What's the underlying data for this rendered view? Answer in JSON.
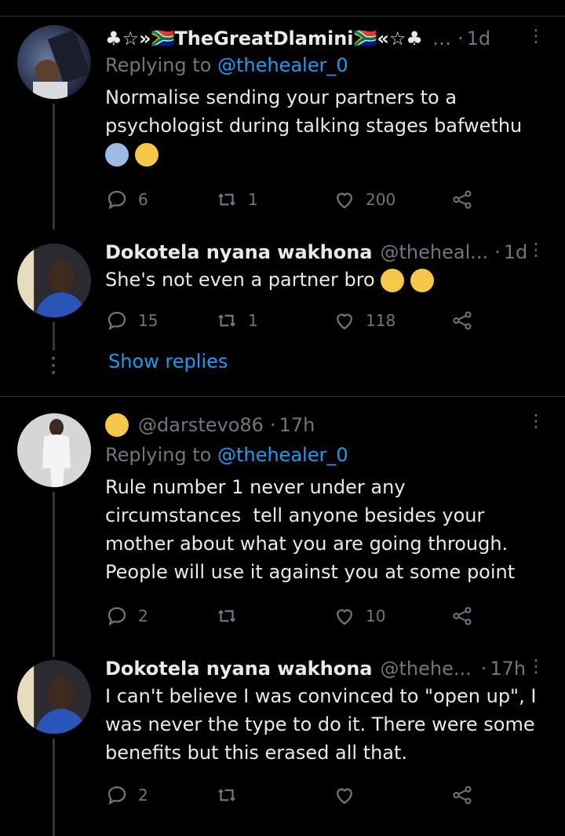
{
  "tweets": [
    {
      "name": "♣☆»🇿🇦TheGreatDlamini🇿🇦«☆♣",
      "handle": "…",
      "time": "1d",
      "replying_label": "Replying to",
      "replying_to": "@thehealer_0",
      "text": "Normalise sending your partners to a psychologist during talking stages bafwethu",
      "reply_count": "6",
      "retweet_count": "1",
      "like_count": "200"
    },
    {
      "name": "Dokotela nyana wakhona",
      "handle": "@theheal...",
      "time": "1d",
      "text": "She's not even a partner bro",
      "reply_count": "15",
      "retweet_count": "1",
      "like_count": "118"
    },
    {
      "name": "",
      "handle": "@darstevo86",
      "time": "17h",
      "replying_label": "Replying to",
      "replying_to": "@thehealer_0",
      "text": "Rule number 1 never under any circumstances  tell anyone besides your mother about what you are going through. People will use it against you at some point",
      "reply_count": "2",
      "retweet_count": "",
      "like_count": "10"
    },
    {
      "name": "Dokotela nyana wakhona",
      "handle": "@thehe...",
      "time": "17h",
      "text": "I can't believe I was convinced to \"open up\", I was never the type to do it. There were some benefits but this erased all that.",
      "reply_count": "2",
      "retweet_count": "",
      "like_count": ""
    }
  ],
  "show_replies_label": "Show replies",
  "colors": {
    "accent": "#1d9bf0",
    "muted": "#71767b",
    "background": "#000000"
  }
}
